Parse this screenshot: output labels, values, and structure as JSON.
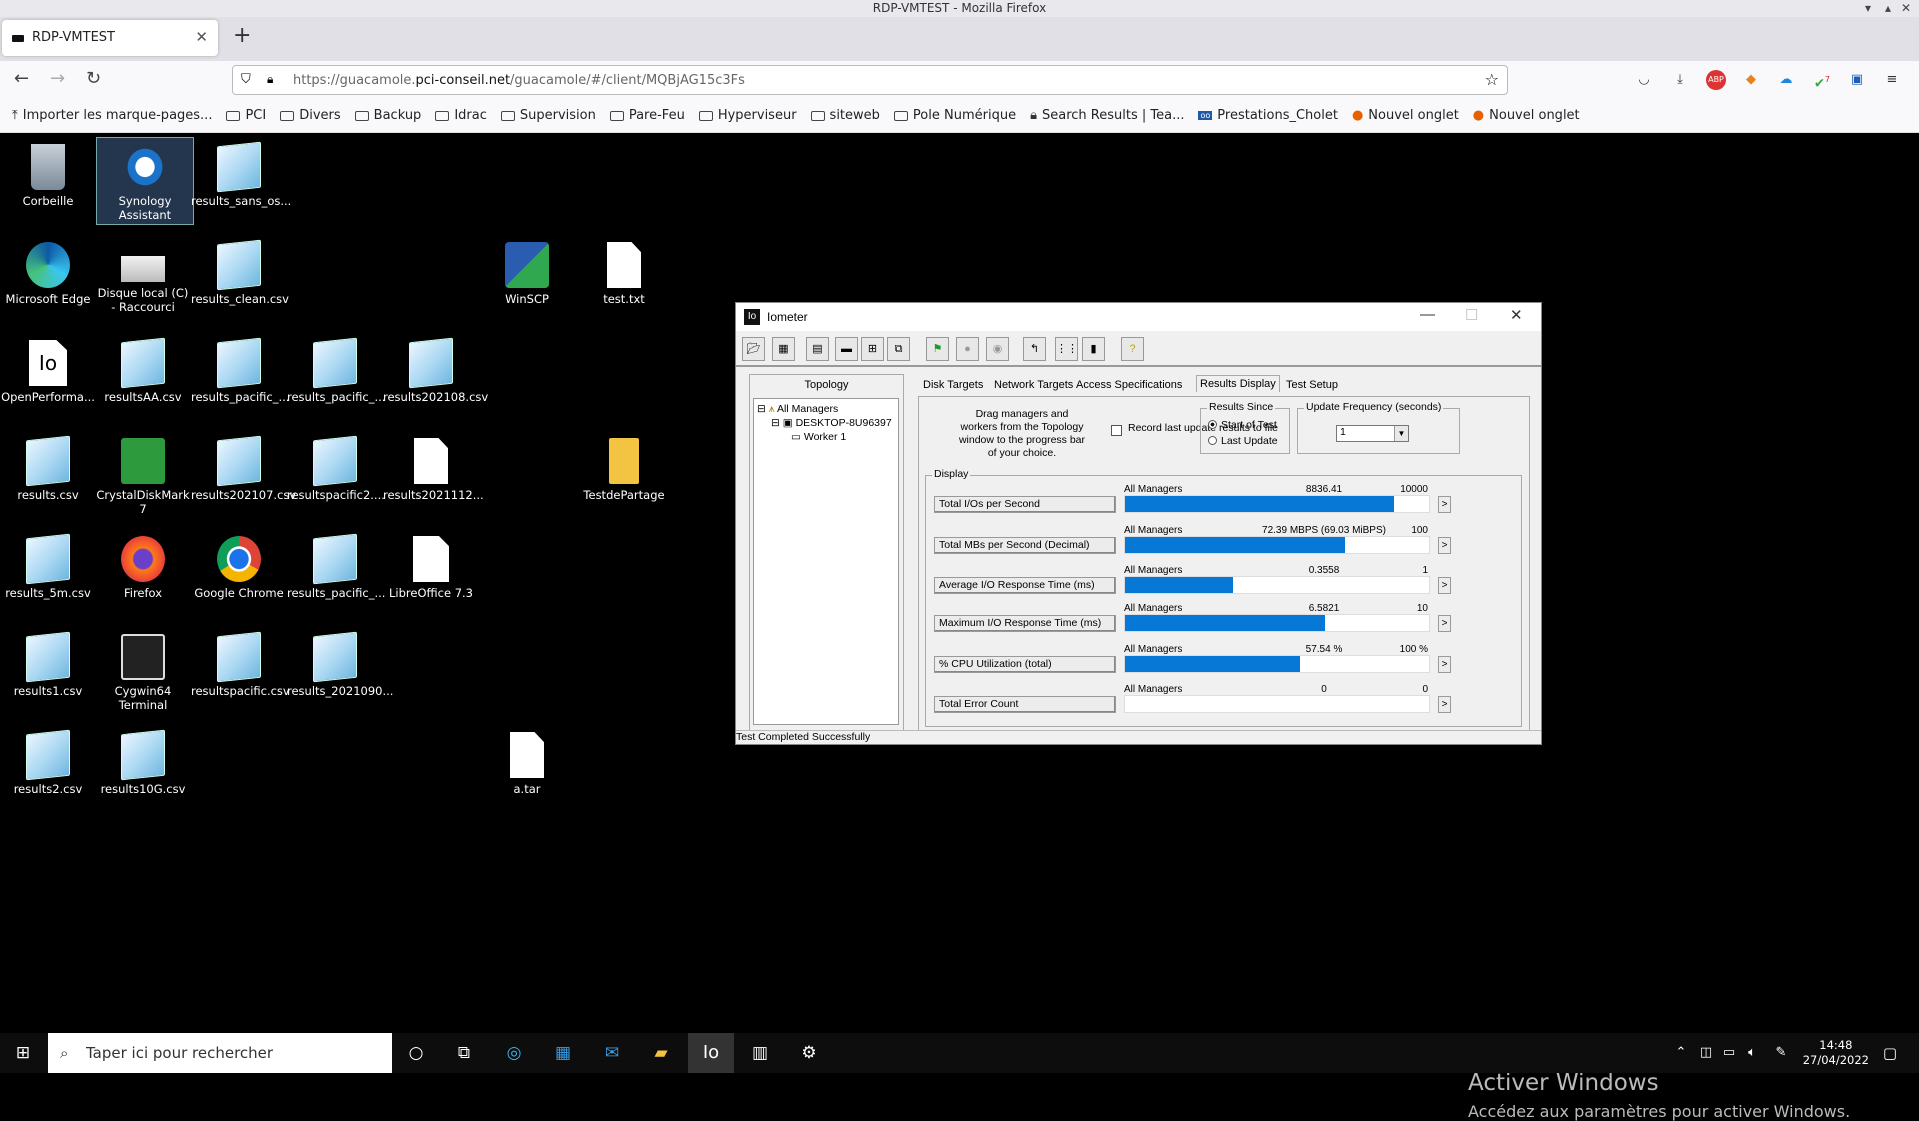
{
  "firefox": {
    "window_title": "RDP-VMTEST - Mozilla Firefox",
    "tab_title": "RDP-VMTEST",
    "url_prefix": "https://guacamole.",
    "url_domain": "pci-conseil.net",
    "url_path": "/guacamole/#/client/MQBjAG15c3Fs",
    "bookmarks": [
      "Importer les marque-pages...",
      "PCI",
      "Divers",
      "Backup",
      "Idrac",
      "Supervision",
      "Pare-Feu",
      "Hyperviseur",
      "siteweb",
      "Pole Numérique",
      "Search Results | Tea...",
      "Prestations_Cholet",
      "Nouvel onglet",
      "Nouvel onglet"
    ],
    "ext_badge": "7"
  },
  "desktop": {
    "icons": [
      {
        "label": "Corbeille"
      },
      {
        "label": "Synology Assistant"
      },
      {
        "label": "results_sans_os..."
      },
      {
        "label": "Microsoft Edge"
      },
      {
        "label": "Disque local (C) - Raccourci"
      },
      {
        "label": "results_clean.csv"
      },
      {
        "label": "WinSCP"
      },
      {
        "label": "test.txt"
      },
      {
        "label": "OpenPerforma..."
      },
      {
        "label": "resultsAA.csv"
      },
      {
        "label": "results_pacific_..."
      },
      {
        "label": "results_pacific_..."
      },
      {
        "label": "results202108.csv"
      },
      {
        "label": "results.csv"
      },
      {
        "label": "CrystalDiskMark 7"
      },
      {
        "label": "results202107.csv"
      },
      {
        "label": "resultspacific2...."
      },
      {
        "label": "results2021112..."
      },
      {
        "label": "TestdePartage"
      },
      {
        "label": "results_5m.csv"
      },
      {
        "label": "Firefox"
      },
      {
        "label": "Google Chrome"
      },
      {
        "label": "results_pacific_..."
      },
      {
        "label": "LibreOffice 7.3"
      },
      {
        "label": "results1.csv"
      },
      {
        "label": "Cygwin64 Terminal"
      },
      {
        "label": "resultspacific.csv"
      },
      {
        "label": "results_2021090..."
      },
      {
        "label": "results2.csv"
      },
      {
        "label": "results10G.csv"
      },
      {
        "label": "a.tar"
      }
    ],
    "activate_title": "Activer Windows",
    "activate_sub": "Accédez aux paramètres pour activer Windows."
  },
  "iometer": {
    "title": "Iometer",
    "logo": "Io",
    "topology_label": "Topology",
    "tree": [
      "All Managers",
      "DESKTOP-8U96397",
      "Worker 1"
    ],
    "tabs": [
      "Disk Targets",
      "Network Targets",
      "Access Specifications",
      "Results Display",
      "Test Setup"
    ],
    "drag_text": "Drag managers and workers from the Topology window to the progress bar of your choice.",
    "record_label": "Record last update results to file",
    "results_since_label": "Results Since",
    "radio_start": "Start of Test",
    "radio_last": "Last Update",
    "update_freq_label": "Update Frequency (seconds)",
    "update_freq_value": "1",
    "display_label": "Display",
    "rows": [
      {
        "name": "Total I/Os per Second",
        "scope": "All Managers",
        "value": "8836.41",
        "max": "10000",
        "fraction": 0.884
      },
      {
        "name": "Total MBs per Second (Decimal)",
        "scope": "All Managers",
        "value": "72.39 MBPS (69.03 MiBPS)",
        "max": "100",
        "fraction": 0.724
      },
      {
        "name": "Average I/O Response Time (ms)",
        "scope": "All Managers",
        "value": "0.3558",
        "max": "1",
        "fraction": 0.356
      },
      {
        "name": "Maximum I/O Response Time (ms)",
        "scope": "All Managers",
        "value": "6.5821",
        "max": "10",
        "fraction": 0.658
      },
      {
        "name": "% CPU Utilization (total)",
        "scope": "All Managers",
        "value": "57.54 %",
        "max": "100 %",
        "fraction": 0.575
      },
      {
        "name": "Total Error Count",
        "scope": "All Managers",
        "value": "0",
        "max": "0",
        "fraction": 0
      }
    ],
    "status": "Test Completed Successfully"
  },
  "taskbar": {
    "search_placeholder": "Taper ici pour rechercher",
    "time": "14:48",
    "date": "27/04/2022"
  }
}
